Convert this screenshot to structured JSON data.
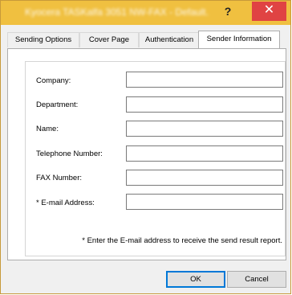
{
  "window": {
    "title": "Kyocera TASKalfa 3051 NW-FAX - Default..."
  },
  "titlebar": {
    "help_label": "?",
    "close_label": "✕"
  },
  "tabs": [
    {
      "label": "Sending Options",
      "active": false
    },
    {
      "label": "Cover Page",
      "active": false
    },
    {
      "label": "Authentication",
      "active": false
    },
    {
      "label": "Sender Information",
      "active": true
    }
  ],
  "form": {
    "fields": [
      {
        "label": "Company:",
        "value": ""
      },
      {
        "label": "Department:",
        "value": ""
      },
      {
        "label": "Name:",
        "value": ""
      },
      {
        "label": "Telephone Number:",
        "value": ""
      },
      {
        "label": "FAX Number:",
        "value": ""
      },
      {
        "label": "* E-mail Address:",
        "value": ""
      }
    ],
    "note": "* Enter the E-mail address to receive the send result report."
  },
  "buttons": {
    "ok_label": "OK",
    "cancel_label": "Cancel"
  },
  "colors": {
    "titlebar": "#f0c040",
    "close_button": "#e04343",
    "ok_focus": "#0078d7"
  }
}
